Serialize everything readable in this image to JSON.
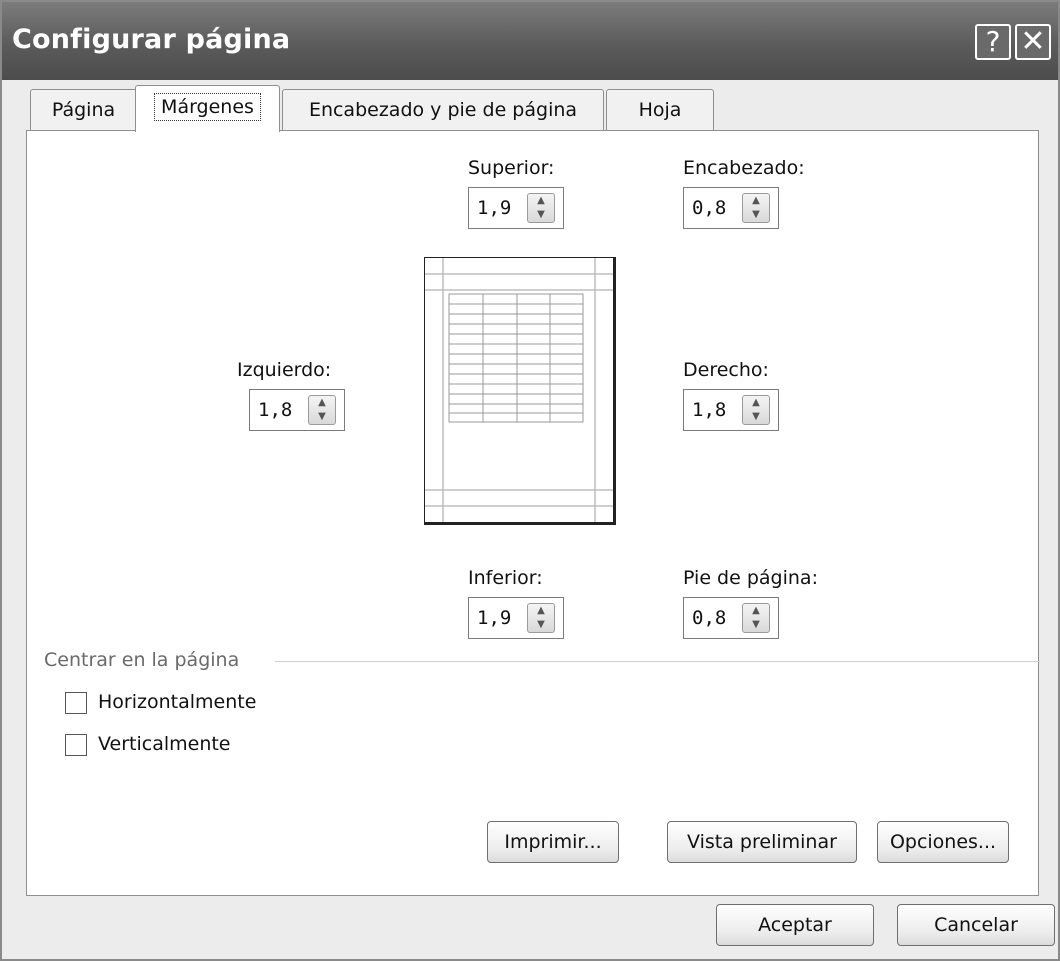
{
  "dialog": {
    "title": "Configurar página",
    "help_glyph": "?",
    "close_glyph": "✕"
  },
  "tabs": [
    {
      "label": "Página"
    },
    {
      "label": "Márgenes",
      "active": true
    },
    {
      "label": "Encabezado y pie de página"
    },
    {
      "label": "Hoja"
    }
  ],
  "margins": {
    "superior": {
      "label": "Superior:",
      "value": "1,9"
    },
    "encabezado": {
      "label": "Encabezado:",
      "value": "0,8"
    },
    "izquierdo": {
      "label": "Izquierdo:",
      "value": "1,8"
    },
    "derecho": {
      "label": "Derecho:",
      "value": "1,8"
    },
    "inferior": {
      "label": "Inferior:",
      "value": "1,9"
    },
    "pie": {
      "label": "Pie de página:",
      "value": "0,8"
    }
  },
  "centrar": {
    "group_label": "Centrar en la página",
    "horizontal": {
      "label": "Horizontalmente",
      "checked": false
    },
    "vertical": {
      "label": "Verticalmente",
      "checked": false
    }
  },
  "buttons": {
    "imprimir": "Imprimir...",
    "vista": "Vista preliminar",
    "opciones": "Opciones...",
    "aceptar": "Aceptar",
    "cancelar": "Cancelar"
  },
  "icons": {
    "spin_up": "up-arrow-icon",
    "spin_down": "down-arrow-icon"
  }
}
